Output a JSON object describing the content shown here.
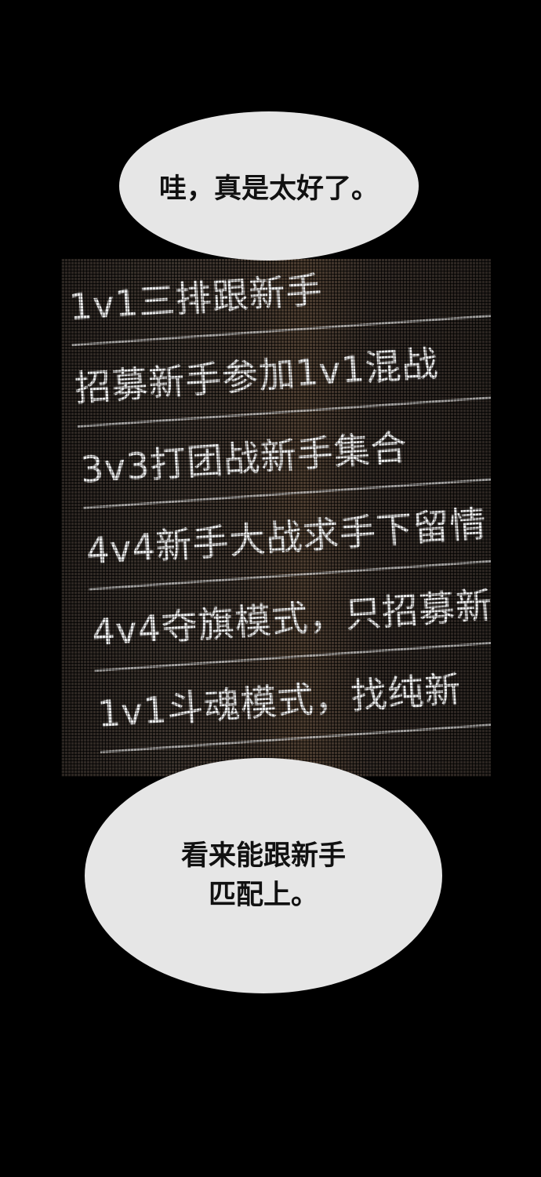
{
  "bubble_top": {
    "text": "哇，真是太好了。"
  },
  "screen": {
    "rows": [
      "1v1三排跟新手",
      "招募新手参加1v1混战",
      "3v3打团战新手集合",
      "4v4新手大战求手下留情",
      "4v4夺旗模式，只招募新",
      "1v1斗魂模式，找纯新"
    ]
  },
  "bubble_bottom": {
    "line1": "看来能跟新手",
    "line2": "匹配上。"
  }
}
